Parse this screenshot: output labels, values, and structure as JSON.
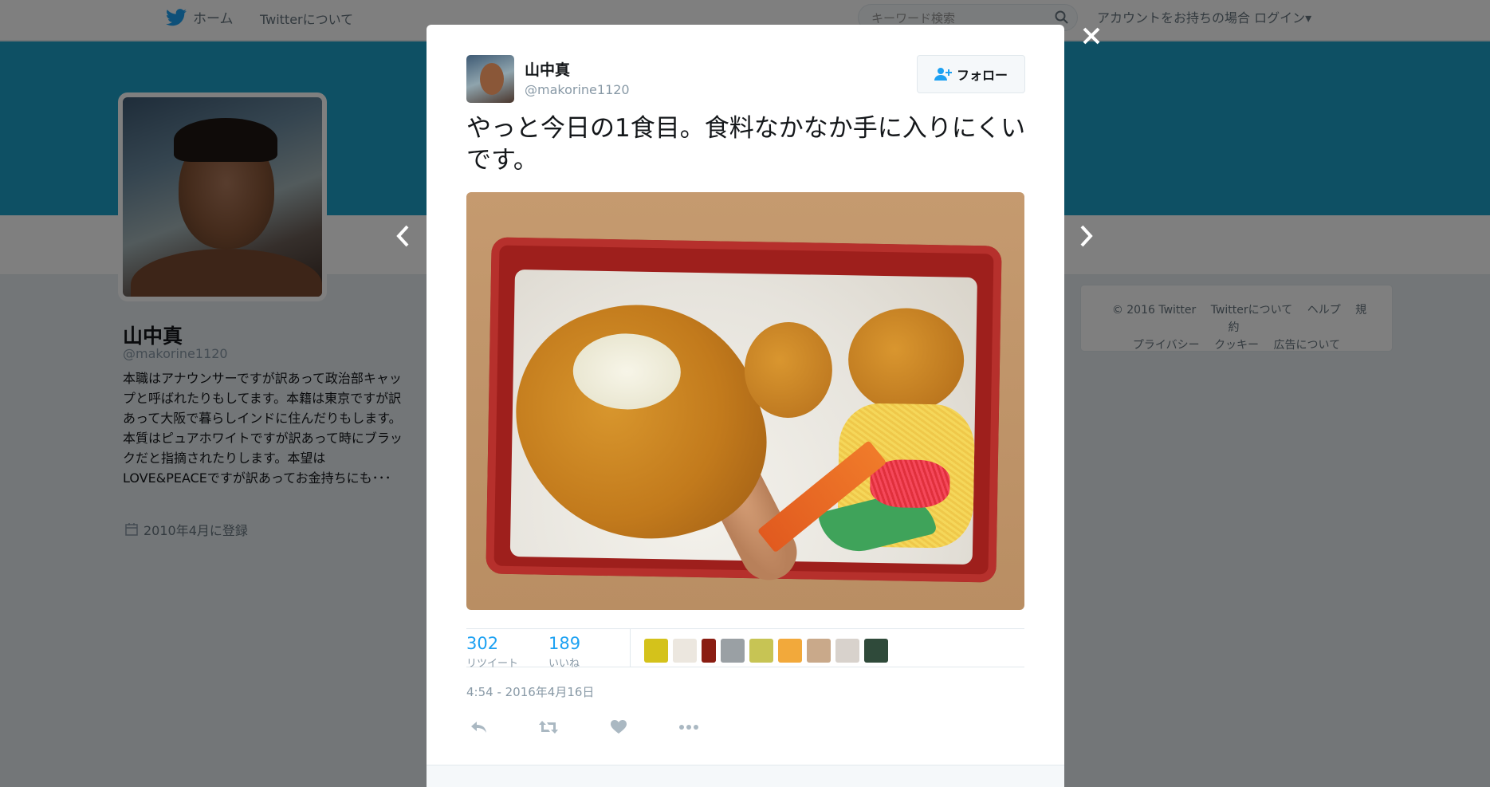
{
  "nav": {
    "home_label": "ホーム",
    "about_label": "Twitterについて",
    "search_placeholder": "キーワード検索",
    "login_label": "アカウントをお持ちの場合 ログイン▾"
  },
  "profile": {
    "name": "山中真",
    "handle": "@makorine1120",
    "bio": "本職はアナウンサーですが訳あって政治部キャップと呼ばれたりもしてます。本籍は東京ですが訳あって大阪で暮らしインドに住んだりもします。本質はピュアホワイトですが訳あって時にブラックだと指摘されたりします。本望はLOVE&PEACEですが訳あってお金持ちにも･･･",
    "joined": "2010年4月に登録"
  },
  "footer": {
    "row1": [
      "© 2016 Twitter",
      "Twitterについて",
      "ヘルプ",
      "規約"
    ],
    "row2": [
      "プライバシー",
      "クッキー",
      "広告について"
    ]
  },
  "tweet": {
    "name": "山中真",
    "handle": "@makorine1120",
    "follow_label": "フォロー",
    "text": "やっと今日の1食目。食料なかなか手に入りにくいです。",
    "retweets": "302",
    "retweets_label": "リツイート",
    "likes": "189",
    "likes_label": "いいね",
    "timestamp": "4:54 - 2016年4月16日"
  },
  "colors": {
    "brand": "#1da1f2",
    "banner": "#1da1c9"
  },
  "icons": [
    "twitter-bird-icon",
    "search-icon",
    "calendar-icon",
    "close-icon",
    "chevron-left-icon",
    "chevron-right-icon",
    "follow-user-icon",
    "reply-icon",
    "retweet-icon",
    "like-icon",
    "more-icon"
  ]
}
